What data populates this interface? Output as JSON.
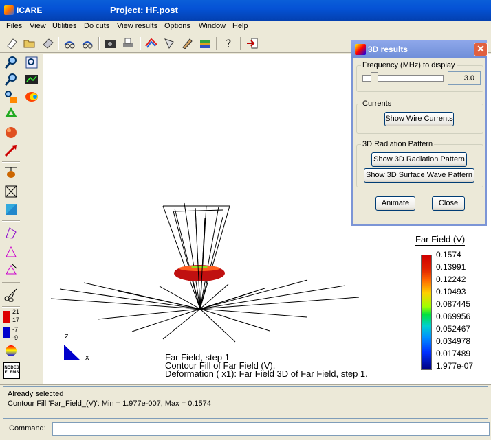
{
  "window": {
    "app_name": "ICARE",
    "title": "Project: HF.post"
  },
  "menu": [
    "Files",
    "View",
    "Utilities",
    "Do cuts",
    "View results",
    "Options",
    "Window",
    "Help"
  ],
  "viewport": {
    "axis_z": "z",
    "axis_x": "x",
    "info_lines": [
      "Far Field, step 1",
      "Contour Fill of Far Field (V).",
      "Deformation ( x1): Far Field 3D of Far Field, step 1."
    ],
    "legend": {
      "title": "Far Field (V)",
      "values": [
        "0.1574",
        "0.13991",
        "0.12242",
        "0.10493",
        "0.087445",
        "0.069956",
        "0.052467",
        "0.034978",
        "0.017489",
        "1.977e-07"
      ]
    }
  },
  "left_tools": {
    "range_labels": [
      "21",
      "17",
      "-7",
      "-9"
    ],
    "nodes_label": "NODES ELEMS"
  },
  "dialog": {
    "title": "3D results",
    "close_glyph": "✕",
    "frequency": {
      "legend": "Frequency (MHz) to display",
      "value": "3.0",
      "slider_level": 0.1
    },
    "currents": {
      "legend": "Currents",
      "show_wire_currents": "Show Wire Currents"
    },
    "radiation": {
      "legend": "3D Radiation Pattern",
      "show_3d_radiation": "Show 3D Radiation Pattern",
      "show_3d_surface_wave": "Show 3D Surface Wave Pattern"
    },
    "animate": "Animate",
    "close": "Close"
  },
  "messages": [
    "Already selected",
    "Contour Fill 'Far_Field_(V)': Min = 1.977e-007, Max = 0.1574"
  ],
  "command": {
    "label": "Command:",
    "value": ""
  },
  "colors": {
    "title_bar": "#0553d6",
    "dialog_title": "#7c95d6",
    "torus": "#c01010"
  }
}
